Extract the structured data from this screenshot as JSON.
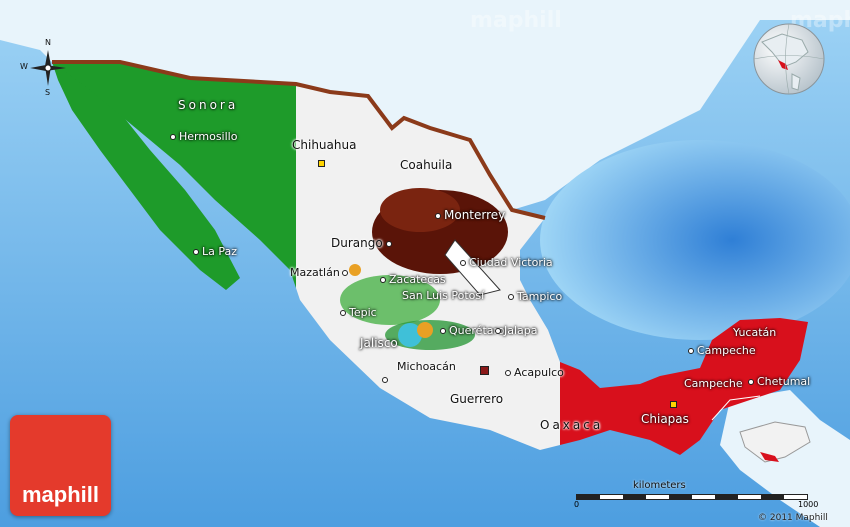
{
  "brand": {
    "logo_text": "maphill",
    "watermark": "maphill"
  },
  "copyright": "© 2011 Maphill",
  "compass": {
    "n": "N",
    "s": "S",
    "w": "W"
  },
  "scale": {
    "title": "kilometers",
    "min": "0",
    "max": "1000"
  },
  "map_labels": {
    "sonora": "Sonora",
    "hermosillo": "Hermosillo",
    "la_paz": "La Paz",
    "chihuahua": "Chihuahua",
    "coahuila": "Coahuila",
    "monterrey": "Monterrey",
    "durango": "Durango",
    "ciudad_victoria": "Ciudad Victoria",
    "zacatecas": "Zacatecas",
    "mazatlan": "Mazatlán",
    "san_luis_potosi": "San Luis Potosí",
    "tampico": "Tampico",
    "tepic": "Tepic",
    "queretaro": "Querétaro",
    "jalapa": "Jalapa",
    "jalisco": "Jalisco",
    "michoacan": "Michoacán",
    "acapulco": "Acapulco",
    "guerrero": "Guerrero",
    "oaxaca": "Oaxaca",
    "chiapas": "Chiapas",
    "yucatan": "Yucatán",
    "campeche_city": "Campeche",
    "campeche_state": "Campeche",
    "chetumal": "Chetumal"
  },
  "colors": {
    "ocean": "#7fc0ee",
    "flag_green": "#1e9b2a",
    "flag_white": "#f1f1f1",
    "flag_red": "#d8101c",
    "land_neighbor": "#e8f4fb",
    "border_brown": "#8b3a1a",
    "logo_red": "#e43a2c"
  }
}
